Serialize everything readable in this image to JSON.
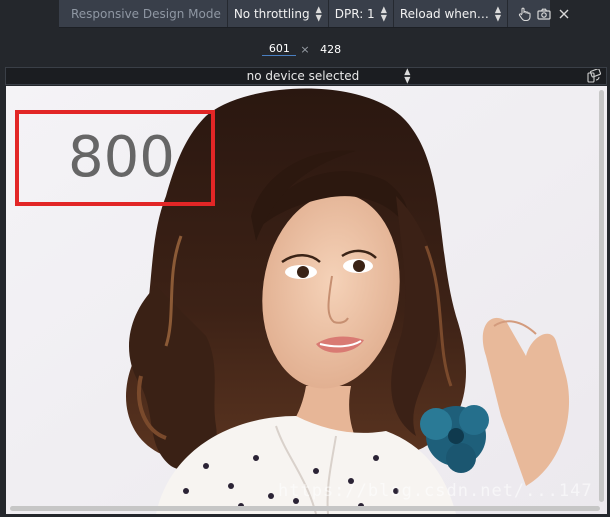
{
  "toolbar": {
    "title": "Responsive Design Mode",
    "throttling": "No throttling",
    "dpr": "DPR: 1",
    "reload": "Reload when…",
    "icons": [
      "touch-icon",
      "camera-icon",
      "close-icon"
    ]
  },
  "viewport_size": {
    "width": "601",
    "height": "428",
    "separator": "×"
  },
  "device": {
    "selected": "no device selected",
    "rotate_icon": "rotate-device-icon"
  },
  "content": {
    "callout_value": "800",
    "watermark": "https://blog.csdn.net/...147"
  },
  "colors": {
    "toolbar_bg": "#393f4a",
    "callout_border": "#e22626",
    "callout_text": "#666666"
  }
}
